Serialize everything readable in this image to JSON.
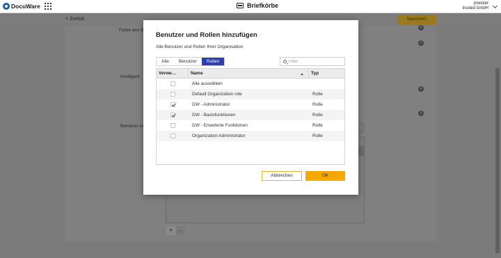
{
  "header": {
    "logo_text": "DocuWare",
    "app_title": "Briefkörbe",
    "user_name": "jmeister",
    "user_org": "trusted GmbH"
  },
  "subbar": {
    "back_label": "< Zurück",
    "save_label": "Speichern"
  },
  "background": {
    "label_color": "Farbe des B",
    "label_intelligent": "Intelligent",
    "label_users": "Benutzer un",
    "add_label": "+",
    "remove_label": "–"
  },
  "dialog": {
    "title": "Benutzer und Rollen hinzufügen",
    "subtitle": "Alle Benutzer und Rollen Ihrer Organisation",
    "tabs": [
      {
        "label": "Alle",
        "active": false
      },
      {
        "label": "Benutzer",
        "active": false
      },
      {
        "label": "Rollen",
        "active": true
      }
    ],
    "filter_placeholder": "Filter",
    "columns": {
      "use": "Verwe…",
      "name": "Name",
      "type": "Typ"
    },
    "rows": [
      {
        "name": "Alle auswählen",
        "type": "",
        "checked": false
      },
      {
        "name": "Default Organization role",
        "type": "Rolle",
        "checked": false
      },
      {
        "name": "DW - Administrator",
        "type": "Rolle",
        "checked": true
      },
      {
        "name": "DW - Basisfunktionen",
        "type": "Rolle",
        "checked": true
      },
      {
        "name": "DW - Erweiterte Funktionen",
        "type": "Rolle",
        "checked": false
      },
      {
        "name": "Organization Administrator",
        "type": "Rolle",
        "checked": false
      }
    ],
    "cancel_label": "Abbrechen",
    "ok_label": "OK"
  },
  "colors": {
    "accent_blue": "#2b3fae",
    "ok_orange": "#f5a800",
    "logo_blue": "#1f5ba8"
  }
}
